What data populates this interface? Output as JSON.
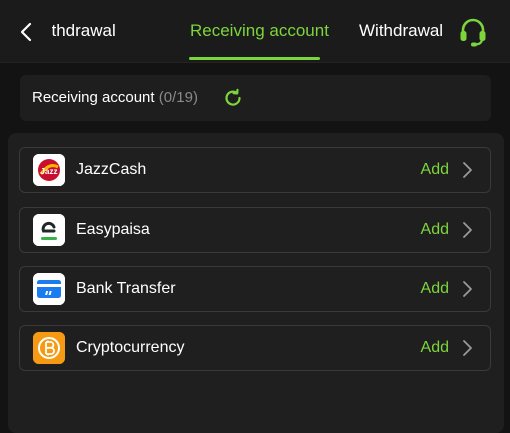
{
  "header": {
    "tabs": [
      {
        "label": "t withdrawal"
      },
      {
        "label": "Receiving account"
      },
      {
        "label": "Withdrawal l"
      }
    ]
  },
  "summary": {
    "label": "Receiving account",
    "count": "(0/19)"
  },
  "accounts": [
    {
      "name": "JazzCash",
      "action": "Add",
      "logo_text": "Jazz"
    },
    {
      "name": "Easypaisa",
      "action": "Add"
    },
    {
      "name": "Bank Transfer",
      "action": "Add"
    },
    {
      "name": "Cryptocurrency",
      "action": "Add"
    }
  ],
  "colors": {
    "accent": "#7dd53c",
    "background": "#131313",
    "card": "#1f1f1f"
  },
  "icons": {
    "back": "chevron-left-icon",
    "support": "headset-icon",
    "refresh": "refresh-icon",
    "row_chevron": "chevron-right-icon"
  }
}
